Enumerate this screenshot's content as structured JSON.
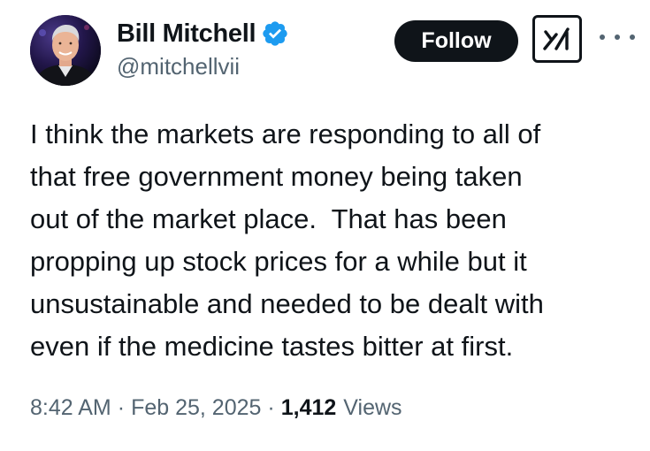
{
  "author": {
    "display_name": "Bill Mitchell",
    "handle": "@mitchellvii",
    "verified": true,
    "verified_color": "#1d9bf0"
  },
  "actions": {
    "follow_label": "Follow",
    "grok_icon": "grok-icon",
    "more_icon": "more-options-icon"
  },
  "tweet": {
    "text": "I think the markets are responding to all of\nthat free government money being taken\nout of the market place.  That has been\npropping up stock prices for a while but it\nunsustainable and needed to be dealt with\neven if the medicine tastes bitter at first."
  },
  "meta": {
    "time": "8:42 AM",
    "separator": "·",
    "date": "Feb 25, 2025",
    "views_count": "1,412",
    "views_label": "Views"
  }
}
